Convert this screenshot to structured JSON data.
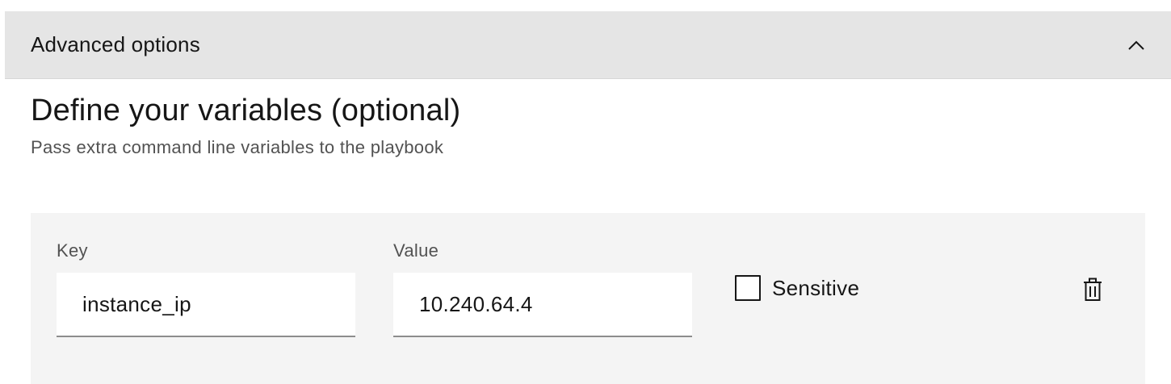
{
  "accordion": {
    "title": "Advanced options",
    "icon": "chevron-up-icon",
    "expanded": true
  },
  "section": {
    "title": "Define your variables (optional)",
    "subtitle": "Pass extra command line variables to the playbook"
  },
  "variable_row": {
    "key": {
      "label": "Key",
      "value": "instance_ip"
    },
    "value": {
      "label": "Value",
      "value": "10.240.64.4"
    },
    "sensitive": {
      "label": "Sensitive",
      "checked": false
    },
    "delete_icon": "trash-can-icon"
  }
}
